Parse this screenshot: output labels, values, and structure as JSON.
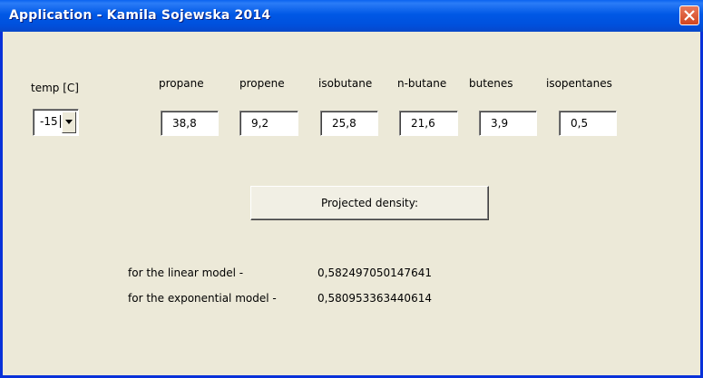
{
  "window": {
    "title": "Application - Kamila Sojewska 2014"
  },
  "temp": {
    "label": "temp [C]",
    "value": "-15"
  },
  "components": [
    {
      "label": "propane",
      "value": "38,8"
    },
    {
      "label": "propene",
      "value": "9,2"
    },
    {
      "label": "isobutane",
      "value": "25,8"
    },
    {
      "label": "n-butane",
      "value": "21,6"
    },
    {
      "label": "butenes",
      "value": "3,9"
    },
    {
      "label": "isopentanes",
      "value": "0,5"
    }
  ],
  "action": {
    "label": "Projected density:"
  },
  "results": [
    {
      "label": "for the linear model -",
      "value": "0,582497050147641"
    },
    {
      "label": "for the exponential model -",
      "value": "0,580953363440614"
    }
  ]
}
